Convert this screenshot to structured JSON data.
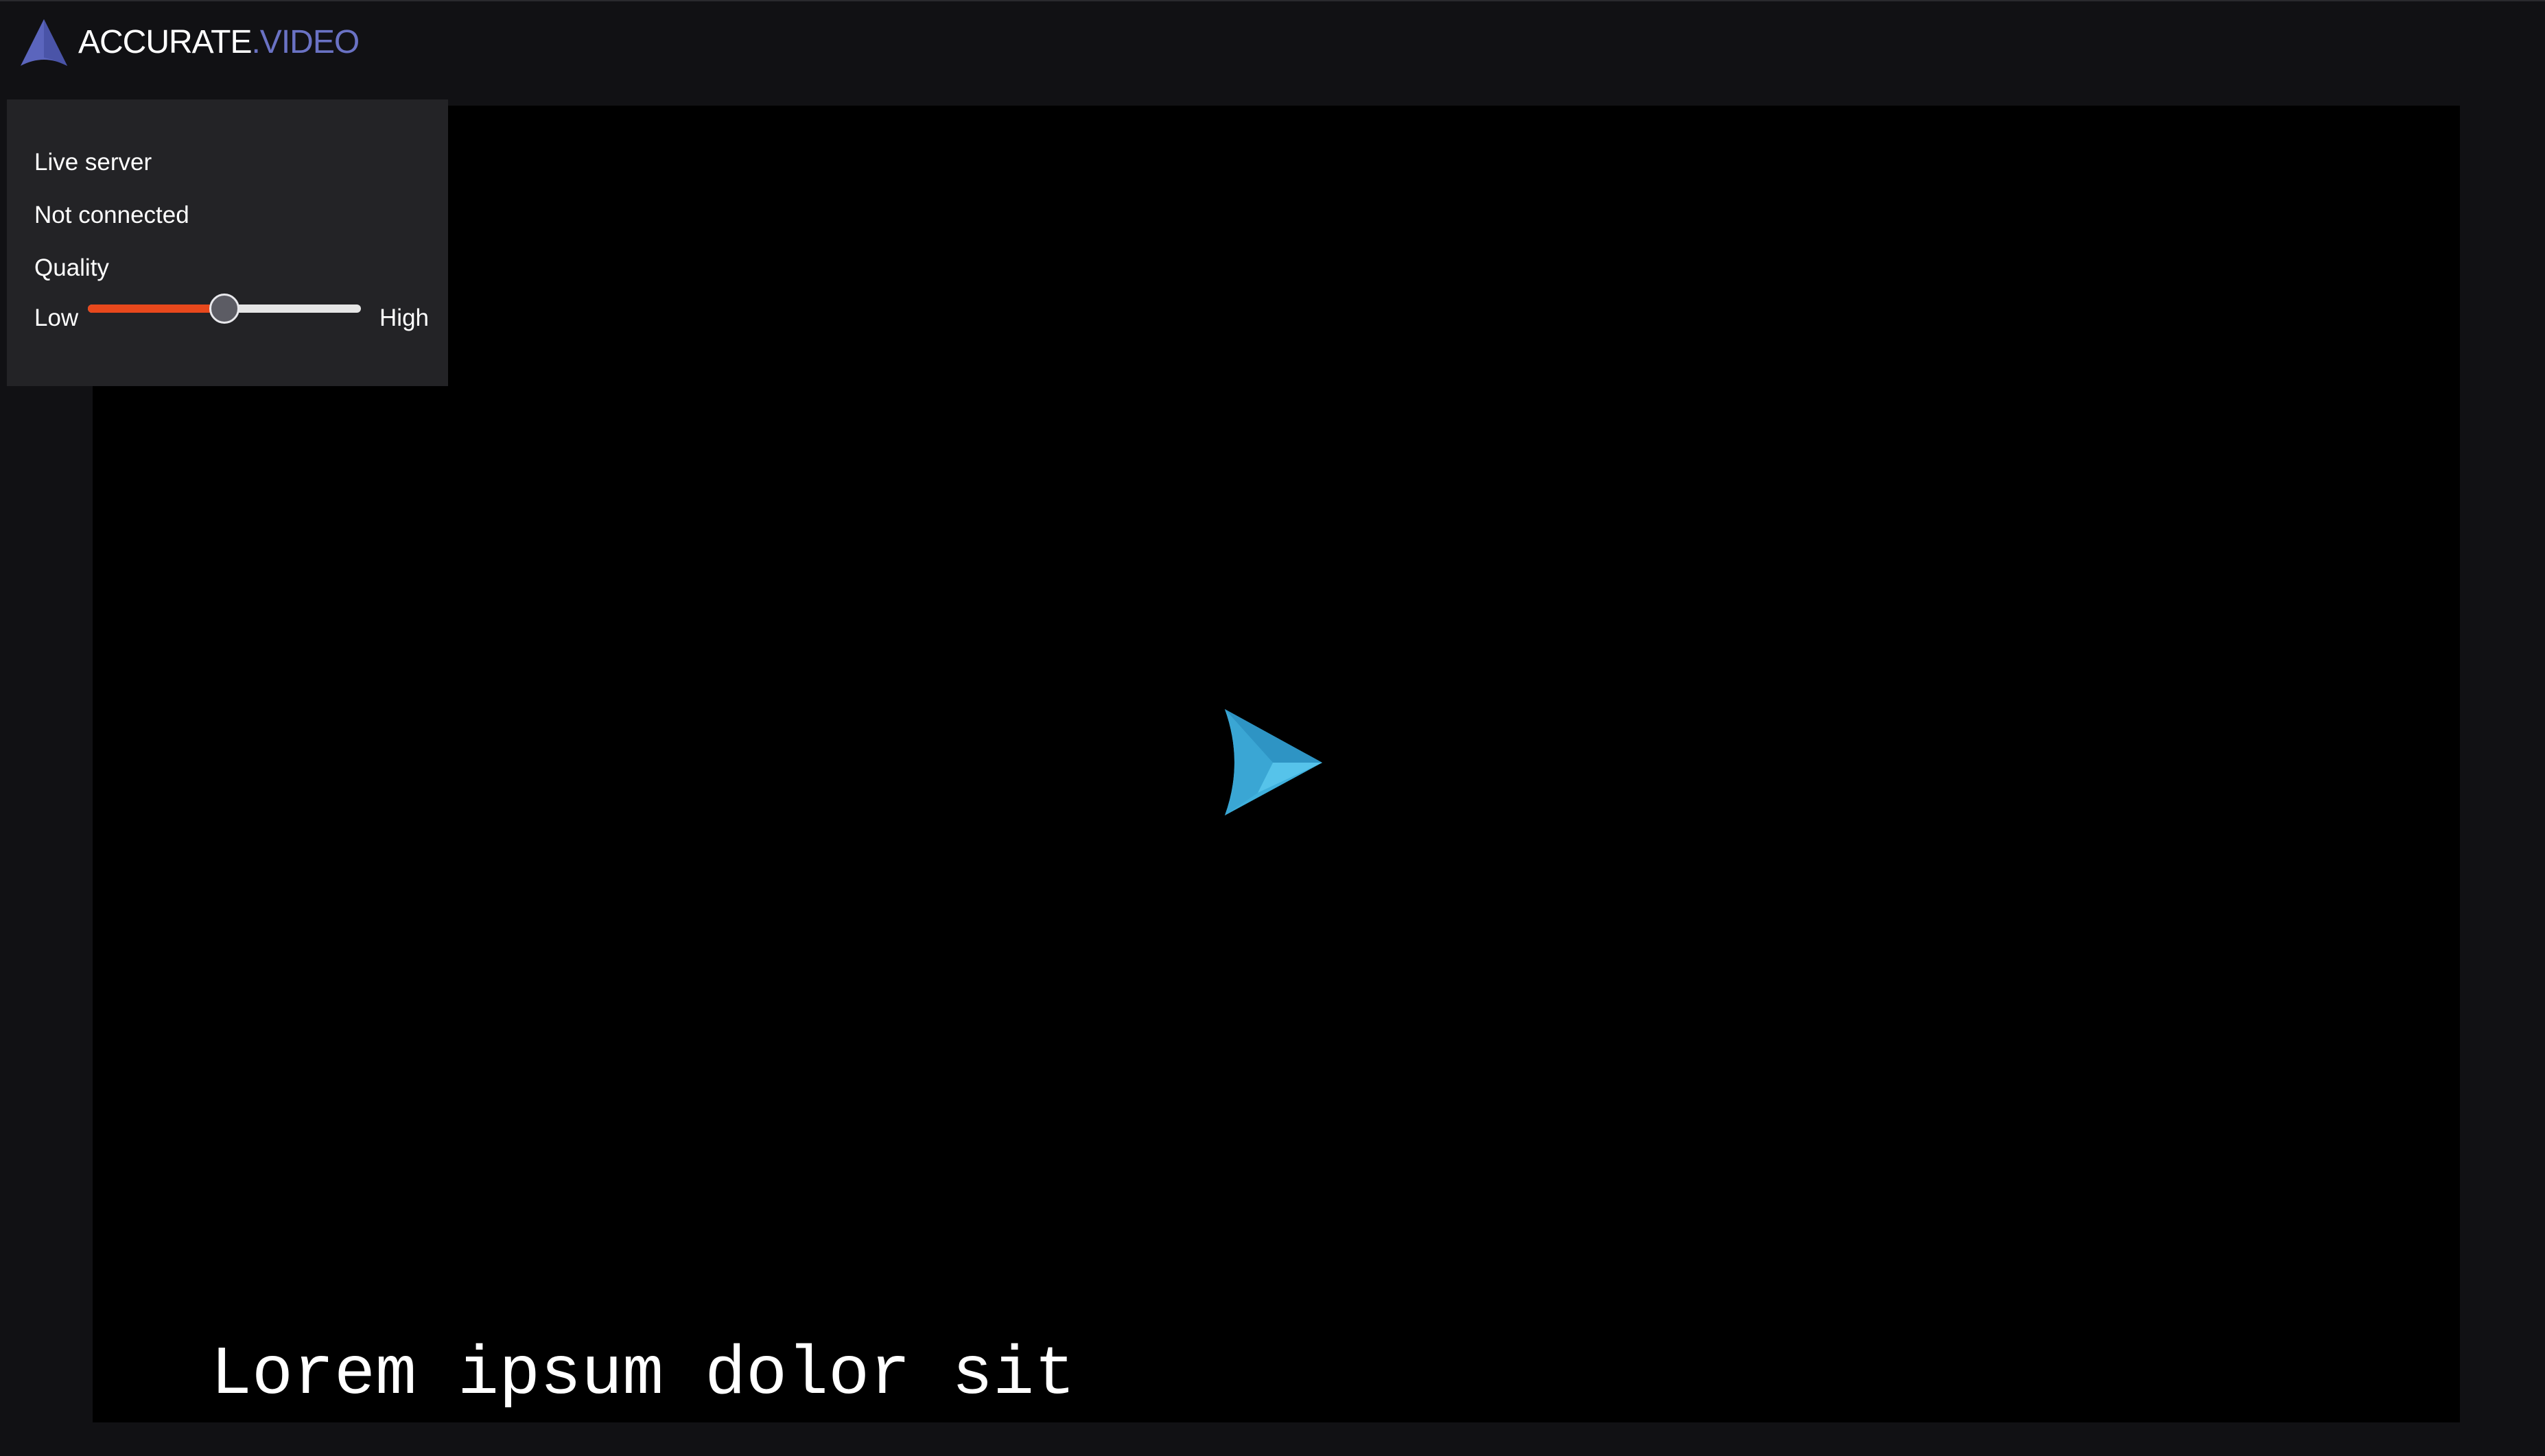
{
  "header": {
    "logo_text_primary": "ACCURATE",
    "logo_text_secondary": ".VIDEO",
    "logo_icon": "accurate-video-logo-icon"
  },
  "settings_panel": {
    "server_label": "Live server",
    "connection_status": "Not connected",
    "quality_label": "Quality",
    "quality_slider": {
      "min_label": "Low",
      "max_label": "High",
      "value": 0.5
    }
  },
  "player": {
    "play_icon": "play-icon",
    "subtitle_text": "Lorem ipsum dolor sit"
  },
  "colors": {
    "background": "#111114",
    "panel": "#232326",
    "player": "#000000",
    "brand_primary": "#ffffff",
    "brand_secondary": "#6a72c4",
    "slider_fill": "#e8481c",
    "slider_track": "#e6e6e6",
    "play_light": "#3fb0dc",
    "play_dark": "#2a8ab8"
  }
}
